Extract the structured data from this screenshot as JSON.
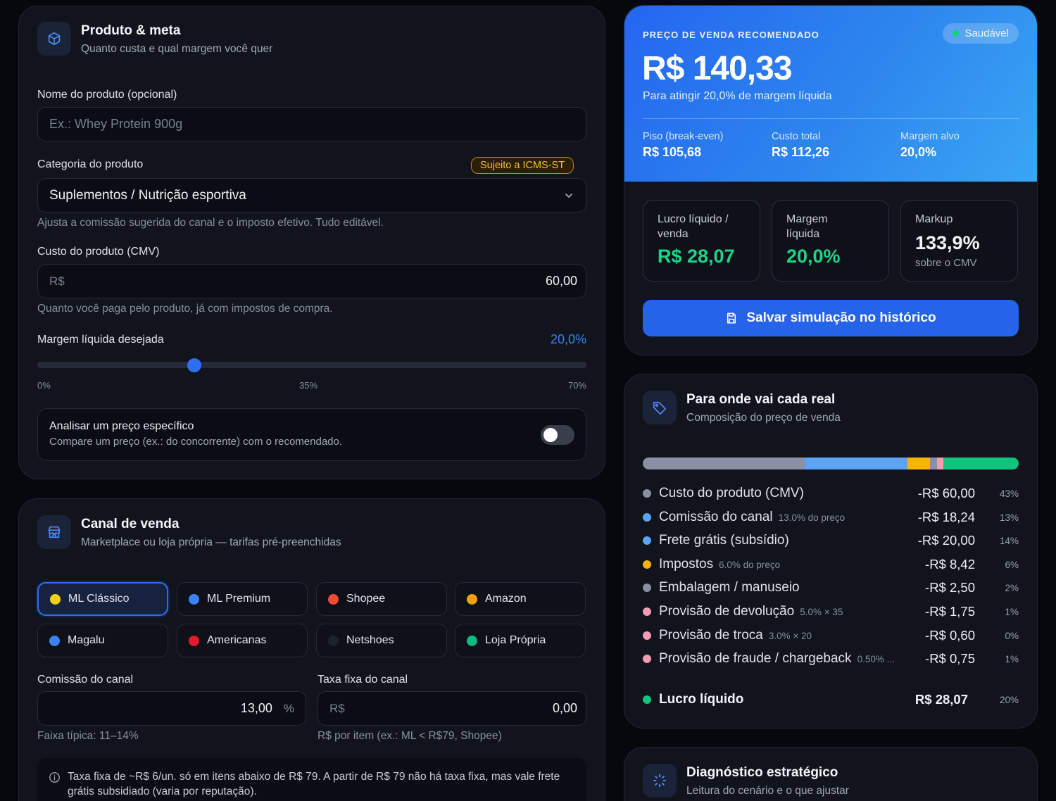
{
  "produto": {
    "title": "Produto & meta",
    "subtitle": "Quanto custa e qual margem você quer",
    "nome_label": "Nome do produto (opcional)",
    "nome_placeholder": "Ex.: Whey Protein 900g",
    "categoria_label": "Categoria do produto",
    "categoria_badge": "Sujeito a ICMS-ST",
    "categoria_value": "Suplementos / Nutrição esportiva",
    "categoria_hint": "Ajusta a comissão sugerida do canal e o imposto efetivo. Tudo editável.",
    "custo_label": "Custo do produto (CMV)",
    "custo_prefix": "R$",
    "custo_value": "60,00",
    "custo_hint": "Quanto você paga pelo produto, já com impostos de compra.",
    "margem_label": "Margem líquida desejada",
    "margem_value": "20,0%",
    "margem_fraction": 0.2857,
    "slider_ticks": [
      "0%",
      "35%",
      "70%"
    ],
    "analisar_title": "Analisar um preço específico",
    "analisar_sub": "Compare um preço (ex.: do concorrente) com o recomendado."
  },
  "canal": {
    "title": "Canal de venda",
    "subtitle": "Marketplace ou loja própria — tarifas pré-preenchidas",
    "channels": [
      {
        "label": "ML Clássico",
        "color": "#facc15",
        "active": true
      },
      {
        "label": "ML Premium",
        "color": "#3b82f6",
        "active": false
      },
      {
        "label": "Shopee",
        "color": "#ef4b36",
        "active": false
      },
      {
        "label": "Amazon",
        "color": "#f59e0b",
        "active": false
      },
      {
        "label": "Magalu",
        "color": "#3b82f6",
        "active": false
      },
      {
        "label": "Americanas",
        "color": "#e11d2a",
        "active": false
      },
      {
        "label": "Netshoes",
        "color": "#1e2230",
        "active": false
      },
      {
        "label": "Loja Própria",
        "color": "#10b981",
        "active": false
      }
    ],
    "comissao_label": "Comissão do canal",
    "comissao_value": "13,00",
    "comissao_suffix": "%",
    "comissao_hint": "Faixa típica: 11–14%",
    "taxa_label": "Taxa fixa do canal",
    "taxa_prefix": "R$",
    "taxa_value": "0,00",
    "taxa_hint": "R$ por item (ex.: ML < R$79, Shopee)",
    "info_text": "Taxa fixa de ~R$ 6/un. só em itens abaixo de R$ 79. A partir de R$ 79 não há taxa fixa, mas vale frete grátis subsidiado (varia por reputação)."
  },
  "hero": {
    "kicker": "PREÇO DE VENDA RECOMENDADO",
    "status": "Saudável",
    "price": "R$ 140,33",
    "subtitle": "Para atingir 20,0% de margem líquida",
    "stats": [
      {
        "label": "Piso (break-even)",
        "value": "R$ 105,68"
      },
      {
        "label": "Custo total",
        "value": "R$ 112,26"
      },
      {
        "label": "Margem alvo",
        "value": "20,0%"
      }
    ]
  },
  "metrics": [
    {
      "label": "Lucro líquido / venda",
      "value": "R$ 28,07",
      "sub": ""
    },
    {
      "label": "Margem líquida",
      "value": "20,0%",
      "sub": ""
    },
    {
      "label": "Markup",
      "value": "133,9%",
      "sub": "sobre o CMV"
    }
  ],
  "save_label": "Salvar simulação no histórico",
  "breakdown": {
    "title": "Para onde vai cada real",
    "subtitle": "Composição do preço de venda",
    "rows": [
      {
        "label": "Custo do produto (CMV)",
        "note": "",
        "value": "-R$ 60,00",
        "pct": "43%",
        "color": "#8b8fa3"
      },
      {
        "label": "Comissão do canal",
        "note": "13.0% do preço",
        "value": "-R$ 18,24",
        "pct": "13%",
        "color": "#5ba4f5"
      },
      {
        "label": "Frete grátis (subsídio)",
        "note": "",
        "value": "-R$ 20,00",
        "pct": "14%",
        "color": "#5ba4f5"
      },
      {
        "label": "Impostos",
        "note": "6.0% do preço",
        "value": "-R$ 8,42",
        "pct": "6%",
        "color": "#f7b500"
      },
      {
        "label": "Embalagem / manuseio",
        "note": "",
        "value": "-R$ 2,50",
        "pct": "2%",
        "color": "#8b8fa3"
      },
      {
        "label": "Provisão de devolução",
        "note": "5.0% × 35",
        "value": "-R$ 1,75",
        "pct": "1%",
        "color": "#f59ab0"
      },
      {
        "label": "Provisão de troca",
        "note": "3.0% × 20",
        "value": "-R$ 0,60",
        "pct": "0%",
        "color": "#f59ab0"
      },
      {
        "label": "Provisão de fraude / chargeback",
        "note": "0.50% ...",
        "value": "-R$ 0,75",
        "pct": "1%",
        "color": "#f59ab0"
      }
    ],
    "profit_label": "Lucro líquido",
    "profit_value": "R$ 28,07",
    "profit_pct": "20%",
    "profit_color": "#10c47e",
    "bar_segments": [
      {
        "value": 60.0,
        "color": "#8b8fa3"
      },
      {
        "value": 38.24,
        "color": "#5ba4f5"
      },
      {
        "value": 8.42,
        "color": "#f7b500"
      },
      {
        "value": 2.5,
        "color": "#8b8fa3"
      },
      {
        "value": 2.35,
        "color": "#f59ab0"
      },
      {
        "value": 28.07,
        "color": "#10c47e"
      }
    ]
  },
  "diag": {
    "title": "Diagnóstico estratégico",
    "subtitle": "Leitura do cenário e o que ajustar"
  }
}
